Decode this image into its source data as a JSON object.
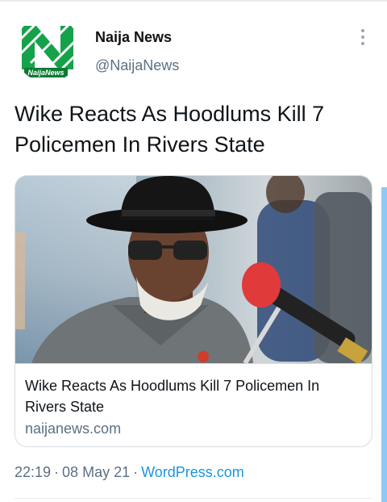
{
  "tweet": {
    "author_name": "Naija News",
    "author_handle": "@NaijaNews",
    "avatar_text": "NaijaNews",
    "text": "Wike Reacts As Hoodlums Kill 7 Policemen In Rivers State",
    "card": {
      "title": "Wike Reacts As Hoodlums Kill 7 Policemen In Rivers State",
      "domain": "naijanews.com"
    },
    "time": "22:19",
    "date": "08 May 21",
    "source": "WordPress.com",
    "separator": "·"
  },
  "colors": {
    "brand_green": "#16a24a",
    "link_blue": "#1b95e0",
    "muted_text": "#5b7083",
    "scroll_accent": "#8fc9f3"
  },
  "icons": [
    "more-vertical-icon"
  ]
}
